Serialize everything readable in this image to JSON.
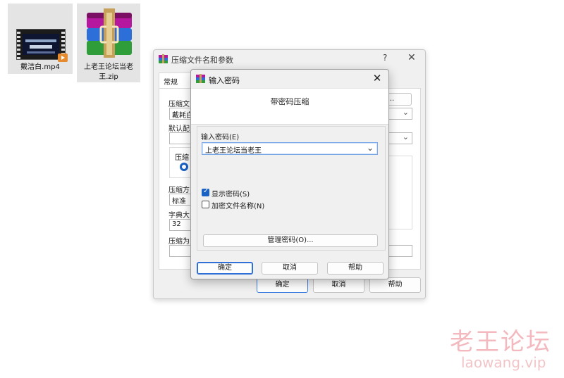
{
  "desktop": {
    "files": [
      {
        "name": "戴洁白.mp4",
        "icon": "video-file-icon"
      },
      {
        "name_line1": "上老王论坛当老",
        "name_line2": "王.zip",
        "icon": "winrar-archive-icon"
      }
    ]
  },
  "back_dialog": {
    "title": "压缩文件名和参数",
    "help": "?",
    "close": "✕",
    "tab_general": "常规",
    "lbl_archive": "压缩文",
    "archive_value": "戴耗白",
    "lbl_default": "默认配",
    "lbl_format": "压缩",
    "radio_partial": "r",
    "lbl_method": "压缩方",
    "method_value": "标准",
    "lbl_dict": "字典大",
    "dict_value": "32",
    "lbl_split": "压缩为",
    "browse_partial": "B)...",
    "btn_ok": "确定",
    "btn_cancel": "取消",
    "btn_help": "帮助"
  },
  "front_dialog": {
    "title": "输入密码",
    "close": "✕",
    "heading": "带密码压缩",
    "password_label": "输入密码(E)",
    "password_value": "上老王论坛当老王",
    "show_password_label": "显示密码(S)",
    "show_password_checked": true,
    "encrypt_names_label": "加密文件名称(N)",
    "encrypt_names_checked": false,
    "manage_button": "管理密码(O)...",
    "btn_ok": "确定",
    "btn_cancel": "取消",
    "btn_help": "帮助"
  },
  "watermark": {
    "title": "老王论坛",
    "url": "laowang.vip"
  },
  "colors": {
    "accent": "#1a62c4",
    "watermark": "#f3b9be"
  }
}
